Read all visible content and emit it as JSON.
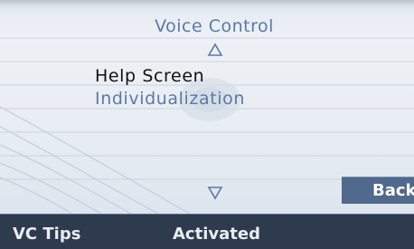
{
  "menu": {
    "title": "Voice Control",
    "scroll_up_glyph": "△",
    "scroll_down_glyph": "▽",
    "items": [
      {
        "label": "Help Screen",
        "selected": true
      },
      {
        "label": "Individualization",
        "selected": false
      }
    ]
  },
  "back_button": {
    "label": "Back"
  },
  "status": {
    "left": "VC Tips",
    "right": "Activated"
  },
  "colors": {
    "accent": "#5a79a8",
    "statusbar": "#2e3a4d",
    "button": "#50698c"
  }
}
